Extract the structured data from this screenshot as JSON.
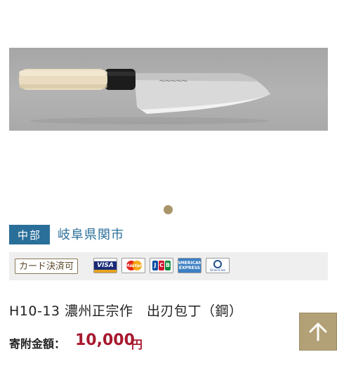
{
  "region": {
    "badge": "中部",
    "city": "岐阜県関市"
  },
  "payment": {
    "card_label": "カード決済可",
    "card_brands": [
      "VISA",
      "MasterCard",
      "JCB",
      "AMERICAN EXPRESS",
      "Diners Club"
    ]
  },
  "product": {
    "title": "H10-13 濃州正宗作　出刃包丁（鋼）"
  },
  "donation": {
    "label": "寄附金額：",
    "amount": "10,000",
    "unit": "円"
  },
  "carousel": {
    "current": 1,
    "total": 1
  },
  "colors": {
    "region_badge": "#2a6f99",
    "accent_gold": "#b2a177",
    "price_red": "#a6192e"
  }
}
